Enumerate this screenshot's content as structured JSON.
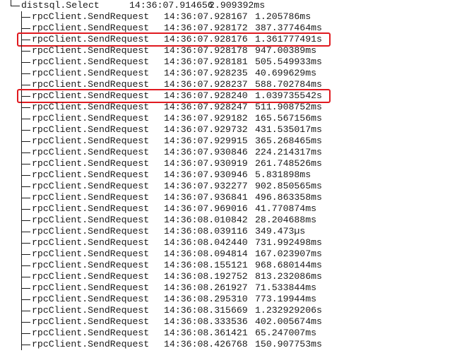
{
  "parent": {
    "name": "distsql.Select",
    "time": "14:36:07.914656",
    "duration": "2.909392ms"
  },
  "children": [
    {
      "name": "rpcClient.SendRequest",
      "time": "14:36:07.928167",
      "duration": "1.205786ms",
      "highlighted": false
    },
    {
      "name": "rpcClient.SendRequest",
      "time": "14:36:07.928172",
      "duration": "387.377464ms",
      "highlighted": false
    },
    {
      "name": "rpcClient.SendRequest",
      "time": "14:36:07.928176",
      "duration": "1.361777491s",
      "highlighted": true
    },
    {
      "name": "rpcClient.SendRequest",
      "time": "14:36:07.928178",
      "duration": "947.00389ms",
      "highlighted": false
    },
    {
      "name": "rpcClient.SendRequest",
      "time": "14:36:07.928181",
      "duration": "505.549933ms",
      "highlighted": false
    },
    {
      "name": "rpcClient.SendRequest",
      "time": "14:36:07.928235",
      "duration": "40.699629ms",
      "highlighted": false
    },
    {
      "name": "rpcClient.SendRequest",
      "time": "14:36:07.928237",
      "duration": "588.702784ms",
      "highlighted": false
    },
    {
      "name": "rpcClient.SendRequest",
      "time": "14:36:07.928240",
      "duration": "1.039735542s",
      "highlighted": true
    },
    {
      "name": "rpcClient.SendRequest",
      "time": "14:36:07.928247",
      "duration": "511.908752ms",
      "highlighted": false
    },
    {
      "name": "rpcClient.SendRequest",
      "time": "14:36:07.929182",
      "duration": "165.567156ms",
      "highlighted": false
    },
    {
      "name": "rpcClient.SendRequest",
      "time": "14:36:07.929732",
      "duration": "431.535017ms",
      "highlighted": false
    },
    {
      "name": "rpcClient.SendRequest",
      "time": "14:36:07.929915",
      "duration": "365.268465ms",
      "highlighted": false
    },
    {
      "name": "rpcClient.SendRequest",
      "time": "14:36:07.930846",
      "duration": "224.214317ms",
      "highlighted": false
    },
    {
      "name": "rpcClient.SendRequest",
      "time": "14:36:07.930919",
      "duration": "261.748526ms",
      "highlighted": false
    },
    {
      "name": "rpcClient.SendRequest",
      "time": "14:36:07.930946",
      "duration": "5.831898ms",
      "highlighted": false
    },
    {
      "name": "rpcClient.SendRequest",
      "time": "14:36:07.932277",
      "duration": "902.850565ms",
      "highlighted": false
    },
    {
      "name": "rpcClient.SendRequest",
      "time": "14:36:07.936841",
      "duration": "496.863358ms",
      "highlighted": false
    },
    {
      "name": "rpcClient.SendRequest",
      "time": "14:36:07.969016",
      "duration": "41.770874ms",
      "highlighted": false
    },
    {
      "name": "rpcClient.SendRequest",
      "time": "14:36:08.010842",
      "duration": "28.204688ms",
      "highlighted": false
    },
    {
      "name": "rpcClient.SendRequest",
      "time": "14:36:08.039116",
      "duration": "349.473µs",
      "highlighted": false
    },
    {
      "name": "rpcClient.SendRequest",
      "time": "14:36:08.042440",
      "duration": "731.992498ms",
      "highlighted": false
    },
    {
      "name": "rpcClient.SendRequest",
      "time": "14:36:08.094814",
      "duration": "167.023907ms",
      "highlighted": false
    },
    {
      "name": "rpcClient.SendRequest",
      "time": "14:36:08.155121",
      "duration": "968.680144ms",
      "highlighted": false
    },
    {
      "name": "rpcClient.SendRequest",
      "time": "14:36:08.192752",
      "duration": "813.232086ms",
      "highlighted": false
    },
    {
      "name": "rpcClient.SendRequest",
      "time": "14:36:08.261927",
      "duration": "71.533844ms",
      "highlighted": false
    },
    {
      "name": "rpcClient.SendRequest",
      "time": "14:36:08.295310",
      "duration": "773.19944ms",
      "highlighted": false
    },
    {
      "name": "rpcClient.SendRequest",
      "time": "14:36:08.315669",
      "duration": "1.232929206s",
      "highlighted": false
    },
    {
      "name": "rpcClient.SendRequest",
      "time": "14:36:08.333536",
      "duration": "402.005674ms",
      "highlighted": false
    },
    {
      "name": "rpcClient.SendRequest",
      "time": "14:36:08.361421",
      "duration": "65.247007ms",
      "highlighted": false
    },
    {
      "name": "rpcClient.SendRequest",
      "time": "14:36:08.426768",
      "duration": "150.907753ms",
      "highlighted": false
    }
  ],
  "colors": {
    "text": "#1a1a1a",
    "highlight": "#e0191f",
    "background": "#ffffff"
  }
}
